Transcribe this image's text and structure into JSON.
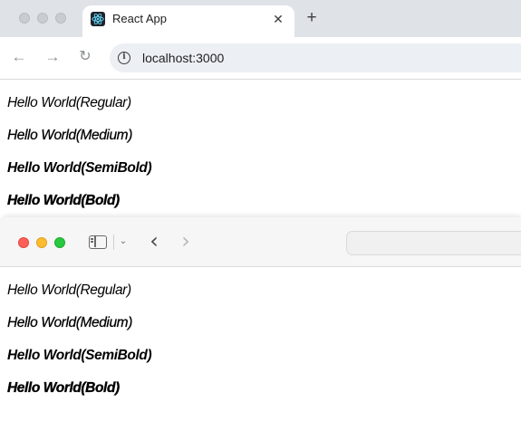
{
  "chrome": {
    "tab": {
      "title": "React App",
      "close_glyph": "✕",
      "favicon": "react-logo-icon"
    },
    "new_tab_glyph": "+",
    "toolbar": {
      "back_glyph": "←",
      "forward_glyph": "→",
      "reload_glyph": "↻",
      "info_glyph": "i",
      "url": "localhost:3000"
    },
    "content": [
      "Hello World(Regular)",
      "Hello World(Medium)",
      "Hello World(SemiBold)",
      "Hello World(Bold)"
    ]
  },
  "safari": {
    "toolbar": {
      "sidebar_icon": "sidebar-icon",
      "chevron_glyph": "⌄",
      "back_glyph": "‹",
      "forward_glyph": "›"
    },
    "content": [
      "Hello World(Regular)",
      "Hello World(Medium)",
      "Hello World(SemiBold)",
      "Hello World(Bold)"
    ]
  },
  "colors": {
    "traffic_red": "#fe5f57",
    "traffic_yellow": "#febc2e",
    "traffic_green": "#28c840",
    "chrome_tabstrip": "#dfe3e8",
    "omnibox": "#eceff4"
  }
}
